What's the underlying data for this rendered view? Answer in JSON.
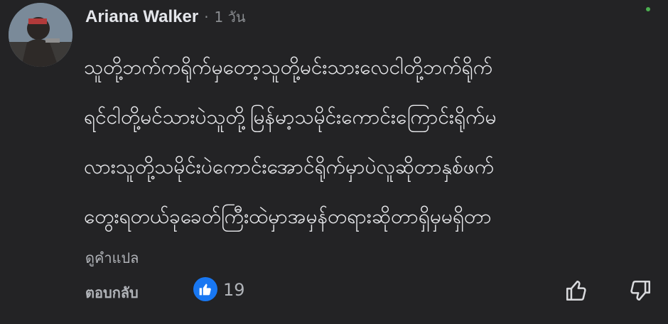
{
  "comment": {
    "author": "Ariana Walker",
    "separator": "·",
    "timestamp": "1 วัน",
    "lines": [
      "သူတို့ဘက်ကရိုက်မှတော့သူတို့မင်းသားလေငါတို့ဘက်ရိုက်",
      "ရင်ငါတို့မင်သားပဲသူတို့မြန်မာ့သမိုင်းကောင်းကြောင်းရိုက်မ",
      "လားသူတို့သမိုင်းပဲကောင်းအောင်ရိုက်မှာပဲလူဆိုတာနှစ်ဖက်",
      "တွေးရတယ်ခုခေတ်ကြီးထဲမှာအမှန်တရားဆိုတာရှိမှမရှိတာ"
    ],
    "translate_label": "ดูคำแปล"
  },
  "footer": {
    "reply_label": "ตอบกลับ",
    "like_count": "19"
  },
  "icons": {
    "reaction": "like-badge-icon",
    "like": "thumbs-up-icon",
    "dislike": "thumbs-down-icon",
    "more": "more-options-icon"
  },
  "colors": {
    "background": "#232325",
    "text_primary": "#e4e6eb",
    "text_secondary": "#b0b3b8",
    "like_blue": "#1877f2"
  }
}
